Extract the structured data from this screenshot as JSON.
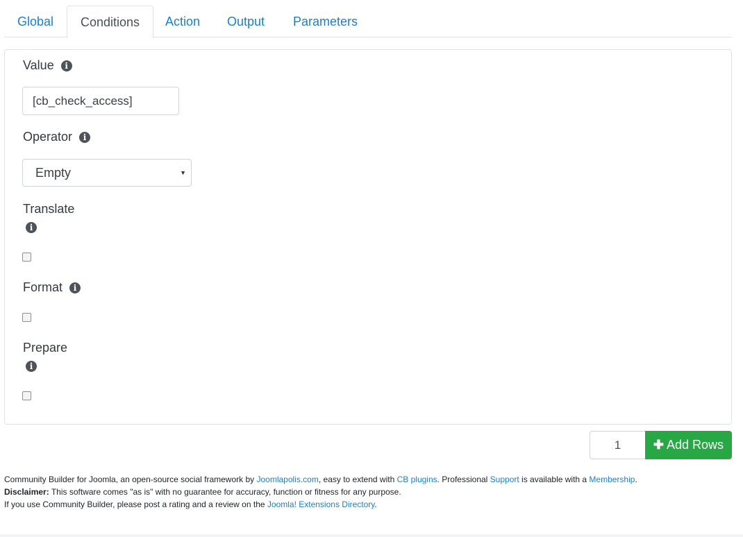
{
  "tabs": [
    {
      "label": "Global",
      "active": false
    },
    {
      "label": "Conditions",
      "active": true
    },
    {
      "label": "Action",
      "active": false
    },
    {
      "label": "Output",
      "active": false
    },
    {
      "label": "Parameters",
      "active": false
    }
  ],
  "fields": {
    "value": {
      "label": "Value",
      "input_value": "[cb_check_access]"
    },
    "operator": {
      "label": "Operator",
      "selected": "Empty"
    },
    "translate": {
      "label": "Translate",
      "checked": false
    },
    "format": {
      "label": "Format",
      "checked": false
    },
    "prepare": {
      "label": "Prepare",
      "checked": false
    }
  },
  "add_rows": {
    "quantity": "1",
    "button_label": "Add Rows",
    "icon": "plus-icon"
  },
  "footer": {
    "line1": {
      "t1": "Community Builder for Joomla, an open-source social framework by ",
      "link1": "Joomlapolis.com",
      "t2": ", easy to extend with ",
      "link2": "CB plugins",
      "t3": ". Professional ",
      "link3": "Support",
      "t4": " is available with a ",
      "link4": "Membership",
      "t5": "."
    },
    "line2": {
      "bold": "Disclaimer:",
      "text": " This software comes \"as is\" with no guarantee for accuracy, function or fitness for any purpose."
    },
    "line3": {
      "text": "If you use Community Builder, please post a rating and a review on the ",
      "link": "Joomla! Extensions Directory",
      "end": "."
    }
  },
  "colors": {
    "link": "#1a7fd4",
    "button": "#28a745",
    "info_icon": "#4d5359"
  }
}
